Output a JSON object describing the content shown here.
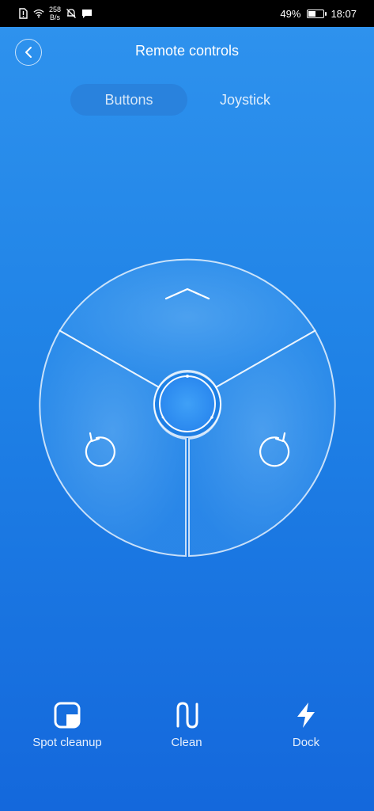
{
  "status_bar": {
    "network_speed_value": "258",
    "network_speed_unit": "B/s",
    "battery_percent": "49%",
    "battery_level": 0.49,
    "time": "18:07"
  },
  "header": {
    "title": "Remote controls"
  },
  "tabs": [
    {
      "label": "Buttons",
      "selected": true
    },
    {
      "label": "Joystick",
      "selected": false
    }
  ],
  "controller": {
    "up_icon": "chevron-up-icon",
    "rotate_left_icon": "rotate-left-icon",
    "rotate_right_icon": "rotate-right-icon"
  },
  "actions": [
    {
      "label": "Spot cleanup",
      "icon": "spot-cleanup-icon"
    },
    {
      "label": "Clean",
      "icon": "clean-icon"
    },
    {
      "label": "Dock",
      "icon": "lightning-icon"
    }
  ],
  "colors": {
    "background_top": "#2f93ee",
    "background_bottom": "#1468dc",
    "accent": "#ffffff"
  }
}
